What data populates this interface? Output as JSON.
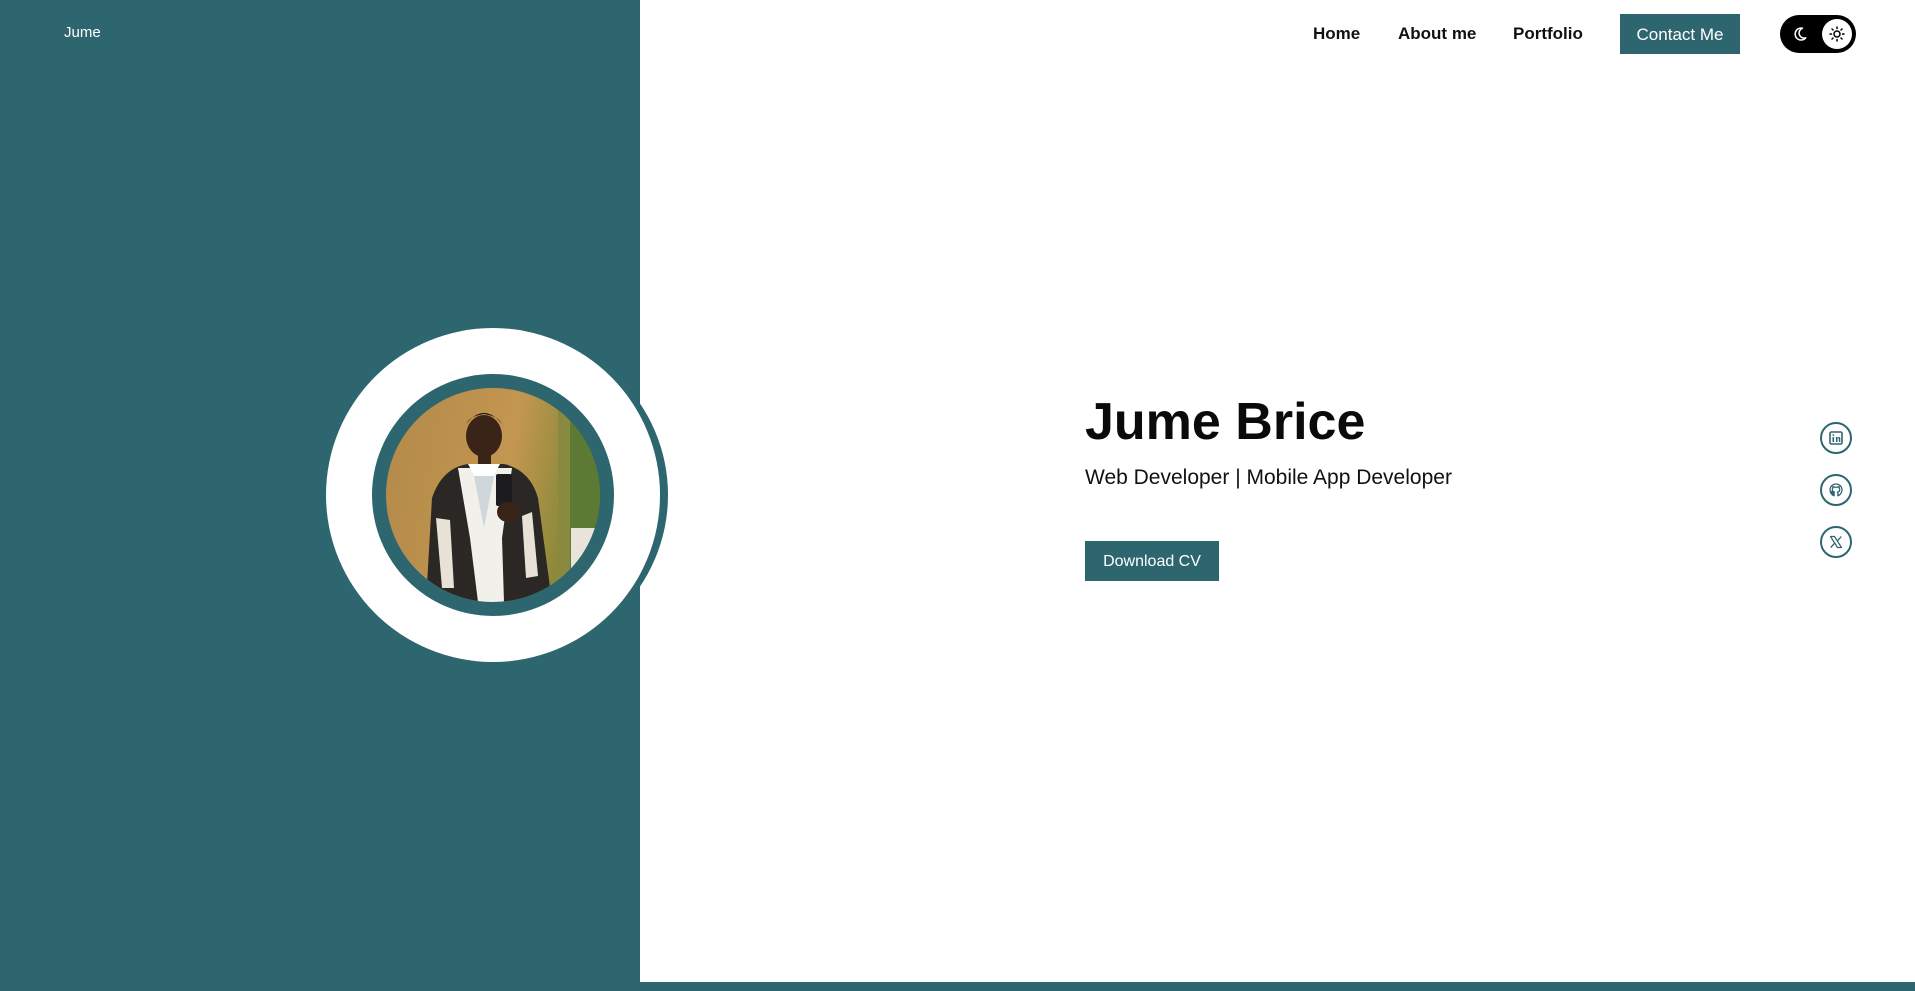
{
  "brand": {
    "name": "Jume"
  },
  "nav": {
    "items": [
      {
        "label": "Home"
      },
      {
        "label": "About me"
      },
      {
        "label": "Portfolio"
      }
    ],
    "contact_label": "Contact Me"
  },
  "theme_toggle": {
    "icons": [
      "moon-icon",
      "sun-icon"
    ],
    "selected": "light"
  },
  "hero": {
    "name": "Jume Brice",
    "role": "Web Developer | Mobile App Developer",
    "download_label": "Download CV"
  },
  "social": {
    "icons": [
      "linkedin-icon",
      "github-icon",
      "x-icon"
    ]
  },
  "colors": {
    "accent": "#2e6670",
    "background": "#ffffff",
    "text": "#0a0a0a",
    "toggle": "#000000"
  }
}
